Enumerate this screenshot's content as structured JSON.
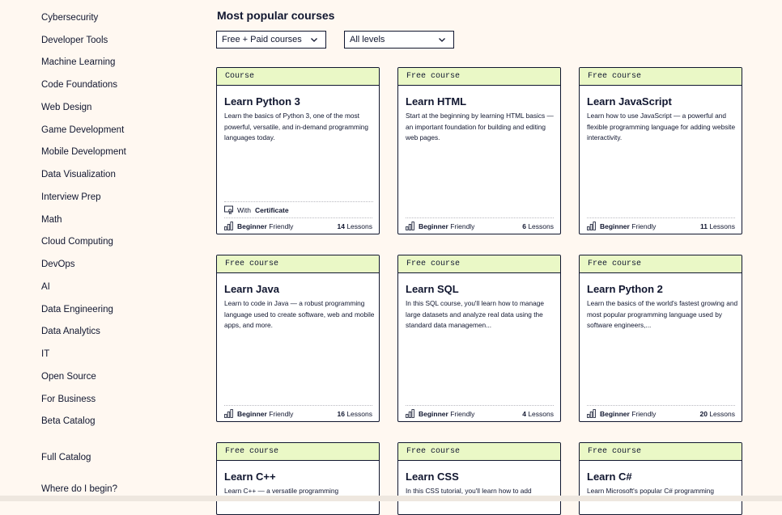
{
  "sidebar": {
    "items": [
      {
        "label": "Cybersecurity"
      },
      {
        "label": "Developer Tools"
      },
      {
        "label": "Machine Learning"
      },
      {
        "label": "Code Foundations"
      },
      {
        "label": "Web Design"
      },
      {
        "label": "Game Development"
      },
      {
        "label": "Mobile Development"
      },
      {
        "label": "Data Visualization"
      },
      {
        "label": "Interview Prep"
      },
      {
        "label": "Math"
      },
      {
        "label": "Cloud Computing"
      },
      {
        "label": "DevOps"
      },
      {
        "label": "AI"
      },
      {
        "label": "Data Engineering"
      },
      {
        "label": "Data Analytics"
      },
      {
        "label": "IT"
      },
      {
        "label": "Open Source"
      },
      {
        "label": "For Business"
      },
      {
        "label": "Beta Catalog"
      }
    ],
    "full_catalog": "Full Catalog",
    "where_begin": "Where do I begin?"
  },
  "main": {
    "title": "Most popular courses",
    "filter_price": "Free + Paid courses",
    "filter_level": "All levels"
  },
  "cards": [
    {
      "band": "Course",
      "title": "Learn Python 3",
      "desc": "Learn the basics of Python 3, one of the most powerful, versatile, and in-demand programming languages today.",
      "cert_prefix": "With",
      "cert_bold": "Certificate",
      "level_bold": "Beginner",
      "level_rest": " Friendly",
      "lessons_num": "14",
      "lessons_word": " Lessons"
    },
    {
      "band": "Free course",
      "title": "Learn HTML",
      "desc": "Start at the beginning by learning HTML basics — an important foundation for building and editing web pages.",
      "level_bold": "Beginner",
      "level_rest": " Friendly",
      "lessons_num": "6",
      "lessons_word": " Lessons"
    },
    {
      "band": "Free course",
      "title": "Learn JavaScript",
      "desc": "Learn how to use JavaScript — a powerful and flexible programming language for adding website interactivity.",
      "level_bold": "Beginner",
      "level_rest": " Friendly",
      "lessons_num": "11",
      "lessons_word": " Lessons"
    },
    {
      "band": "Free course",
      "title": "Learn Java",
      "desc": "Learn to code in Java — a robust programming language used to create software, web and mobile apps, and more.",
      "level_bold": "Beginner",
      "level_rest": " Friendly",
      "lessons_num": "16",
      "lessons_word": " Lessons"
    },
    {
      "band": "Free course",
      "title": "Learn SQL",
      "desc": "In this SQL course, you'll learn how to manage large datasets and analyze real data using the standard data managemen...",
      "level_bold": "Beginner",
      "level_rest": " Friendly",
      "lessons_num": "4",
      "lessons_word": " Lessons"
    },
    {
      "band": "Free course",
      "title": "Learn Python 2",
      "desc": "Learn the basics of the world's fastest growing and most popular programming language used by software engineers,...",
      "level_bold": "Beginner",
      "level_rest": " Friendly",
      "lessons_num": "20",
      "lessons_word": " Lessons"
    },
    {
      "band": "Free course",
      "title": "Learn C++",
      "desc": "Learn C++ — a versatile programming"
    },
    {
      "band": "Free course",
      "title": "Learn CSS",
      "desc": "In this CSS tutorial, you'll learn how to add"
    },
    {
      "band": "Free course",
      "title": "Learn C#",
      "desc": "Learn Microsoft's popular C# programming"
    }
  ],
  "icons": {
    "level": "bar-chart-icon",
    "certificate": "certificate-icon",
    "chevron": "chevron-down-icon"
  },
  "colors": {
    "page_bg": "#fff8f1",
    "band_bg": "#eaf8c6",
    "ink": "#10162f"
  }
}
